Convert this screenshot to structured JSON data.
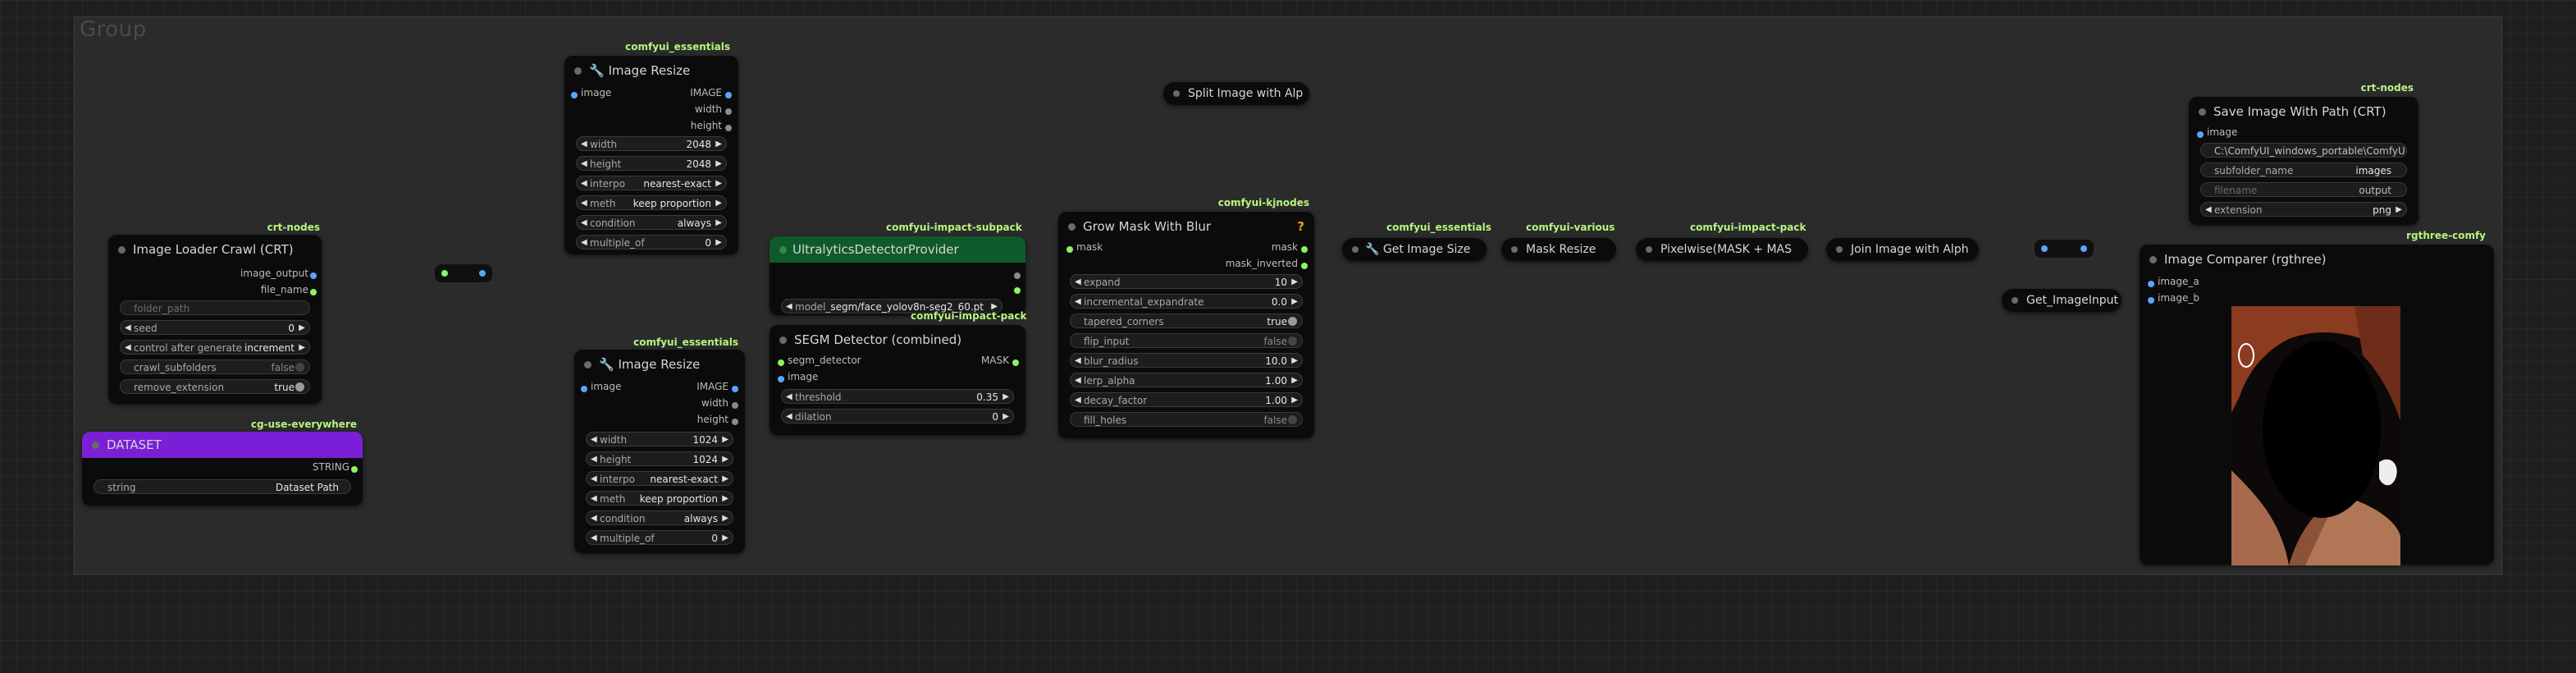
{
  "group": {
    "title": "Group"
  },
  "colors": {
    "image_wire": "#5aa4ff",
    "mask_wire": "#8cf26a",
    "dataset_header": "#7a1fd6",
    "ultralytics_header": "#0f5a2a"
  },
  "nodes": {
    "image_loader": {
      "pack": "crt-nodes",
      "title": "Image Loader Crawl (CRT)",
      "outputs": [
        "image_output",
        "file_name"
      ],
      "widgets": [
        {
          "label": "folder_path",
          "value": ""
        },
        {
          "label": "seed",
          "value": "0"
        },
        {
          "label": "control after generate",
          "value": "increment"
        },
        {
          "label": "crawl_subfolders",
          "value": "false"
        },
        {
          "label": "remove_extension",
          "value": "true"
        }
      ]
    },
    "dataset": {
      "pack": "cg-use-everywhere",
      "title": "DATASET",
      "output": "STRING",
      "widget": {
        "label": "string",
        "value": "Dataset Path"
      }
    },
    "resize_top": {
      "pack": "comfyui_essentials",
      "title": "🔧 Image Resize",
      "input": "image",
      "outputs": [
        "IMAGE",
        "width",
        "height"
      ],
      "widgets": [
        {
          "label": "width",
          "value": "2048"
        },
        {
          "label": "height",
          "value": "2048"
        },
        {
          "label": "interpo",
          "value": "nearest-exact"
        },
        {
          "label": "meth",
          "value": "keep proportion"
        },
        {
          "label": "condition",
          "value": "always"
        },
        {
          "label": "multiple_of",
          "value": "0"
        }
      ]
    },
    "resize_bottom": {
      "pack": "comfyui_essentials",
      "title": "🔧 Image Resize",
      "input": "image",
      "outputs": [
        "IMAGE",
        "width",
        "height"
      ],
      "widgets": [
        {
          "label": "width",
          "value": "1024"
        },
        {
          "label": "height",
          "value": "1024"
        },
        {
          "label": "interpo",
          "value": "nearest-exact"
        },
        {
          "label": "meth",
          "value": "keep proportion"
        },
        {
          "label": "condition",
          "value": "always"
        },
        {
          "label": "multiple_of",
          "value": "0"
        }
      ]
    },
    "ultralytics": {
      "pack": "comfyui-impact-subpack",
      "title": "UltralyticsDetectorProvider",
      "widget": {
        "label": "model_",
        "value": "segm/face_yolov8n-seg2_60.pt"
      }
    },
    "segm": {
      "pack": "comfyui-impact-pack",
      "title": "SEGM Detector (combined)",
      "inputs": [
        "segm_detector",
        "image"
      ],
      "output": "MASK",
      "widgets": [
        {
          "label": "threshold",
          "value": "0.35"
        },
        {
          "label": "dilation",
          "value": "0"
        }
      ]
    },
    "grow_mask": {
      "pack": "comfyui-kjnodes",
      "title": "Grow Mask With Blur",
      "badge": "?",
      "input": "mask",
      "outputs": [
        "mask",
        "mask_inverted"
      ],
      "widgets": [
        {
          "label": "expand",
          "value": "10"
        },
        {
          "label": "incremental_expandrate",
          "value": "0.0"
        },
        {
          "label": "tapered_corners",
          "value": "true"
        },
        {
          "label": "flip_input",
          "value": "false"
        },
        {
          "label": "blur_radius",
          "value": "10.0"
        },
        {
          "label": "lerp_alpha",
          "value": "1.00"
        },
        {
          "label": "decay_factor",
          "value": "1.00"
        },
        {
          "label": "fill_holes",
          "value": "false"
        }
      ]
    },
    "split_image": {
      "title": "Split Image with Alp"
    },
    "get_size": {
      "pack": "comfyui_essentials",
      "title": "🔧 Get Image Size"
    },
    "mask_resize": {
      "pack": "comfyui-various",
      "title": "Mask Resize"
    },
    "pixelwise": {
      "pack": "comfyui-impact-pack",
      "title": "Pixelwise(MASK + MAS"
    },
    "join_image": {
      "title": "Join Image with Alph"
    },
    "save_image": {
      "pack": "crt-nodes",
      "title": "Save Image With Path (CRT)",
      "input": "image",
      "widgets": [
        {
          "label": "",
          "value": "C:\\ComfyUI_windows_portable\\ComfyU..."
        },
        {
          "label": "subfolder_name",
          "value": "images"
        },
        {
          "label": "filename",
          "value": "output"
        },
        {
          "label": "extension",
          "value": "png"
        }
      ]
    },
    "get_image_input": {
      "title": "Get_ImageInput"
    },
    "comparer": {
      "pack": "rgthree-comfy",
      "title": "Image Comparer (rgthree)",
      "inputs": [
        "image_a",
        "image_b"
      ]
    }
  }
}
